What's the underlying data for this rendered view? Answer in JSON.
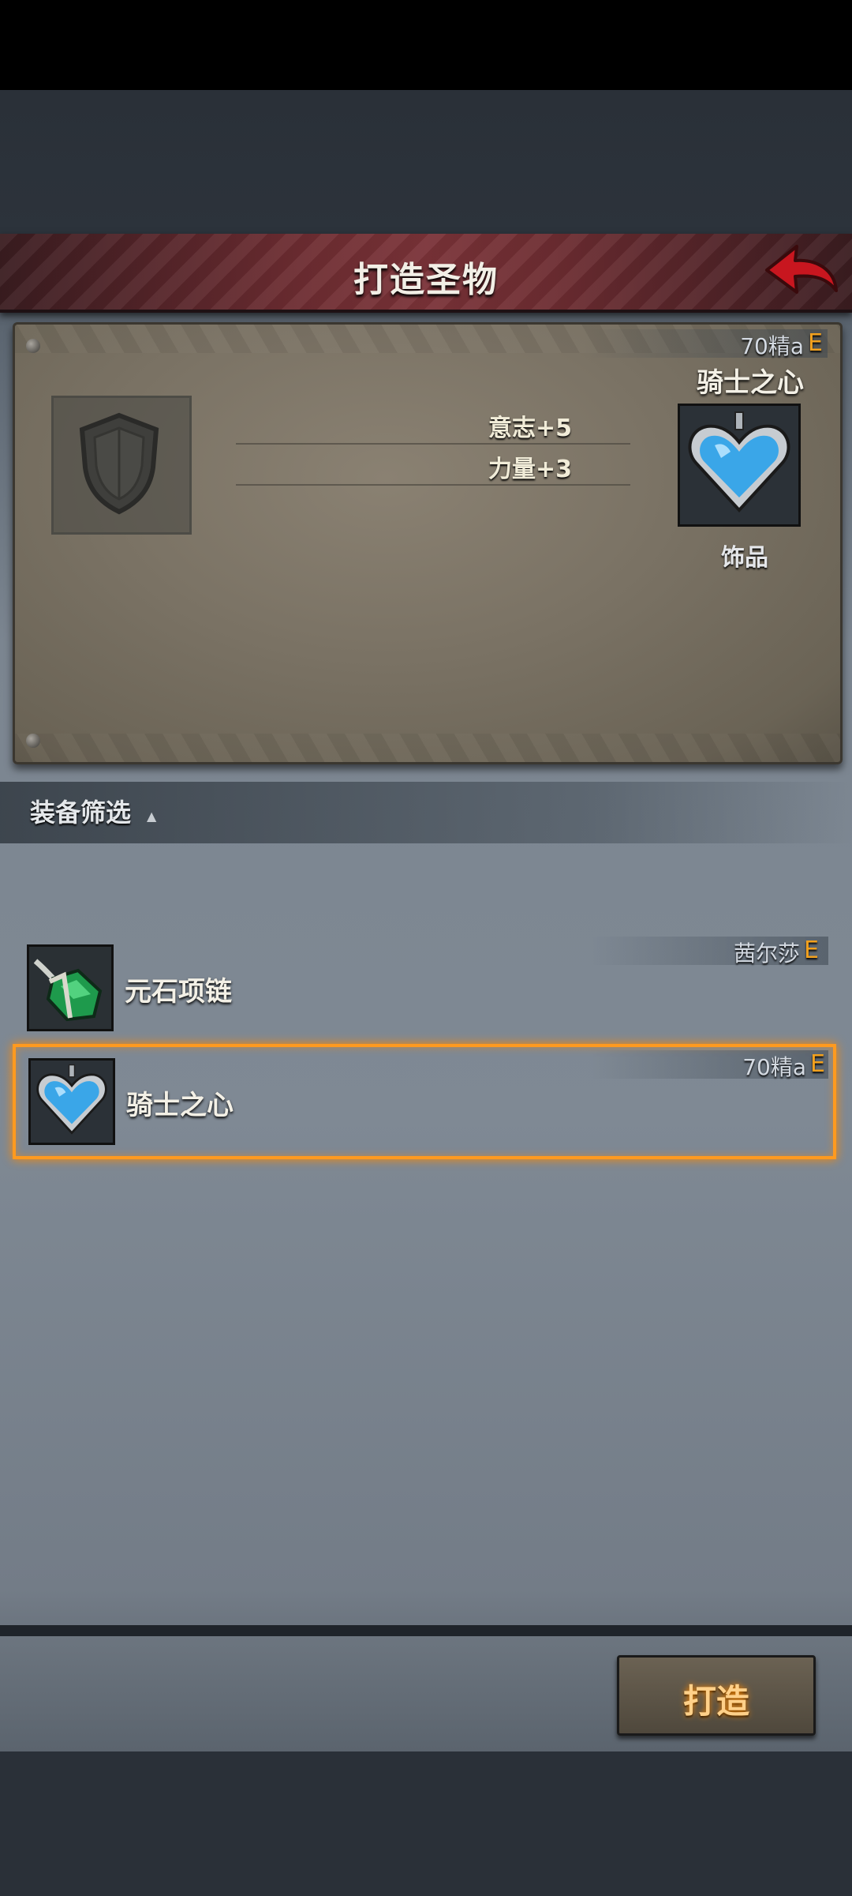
{
  "header": {
    "title": "打造圣物"
  },
  "preview": {
    "level_text": "70精a",
    "grade": "E",
    "item_name": "骑士之心",
    "stats": [
      "意志+5",
      "力量+3"
    ],
    "item_type": "饰品",
    "icon": "heart-pendant-icon"
  },
  "filter": {
    "label": "装备筛选",
    "caret": "▲"
  },
  "list": [
    {
      "tag": "茜尔莎",
      "grade": "E",
      "name": "元石项链",
      "icon": "green-crystal-necklace-icon",
      "selected": false
    },
    {
      "tag": "70精a",
      "grade": "E",
      "name": "骑士之心",
      "icon": "heart-pendant-icon",
      "selected": true
    }
  ],
  "actions": {
    "forge_label": "打造"
  },
  "colors": {
    "accent": "#ff9a1f",
    "grade": "#f2a11e",
    "header": "#6d2c31"
  }
}
